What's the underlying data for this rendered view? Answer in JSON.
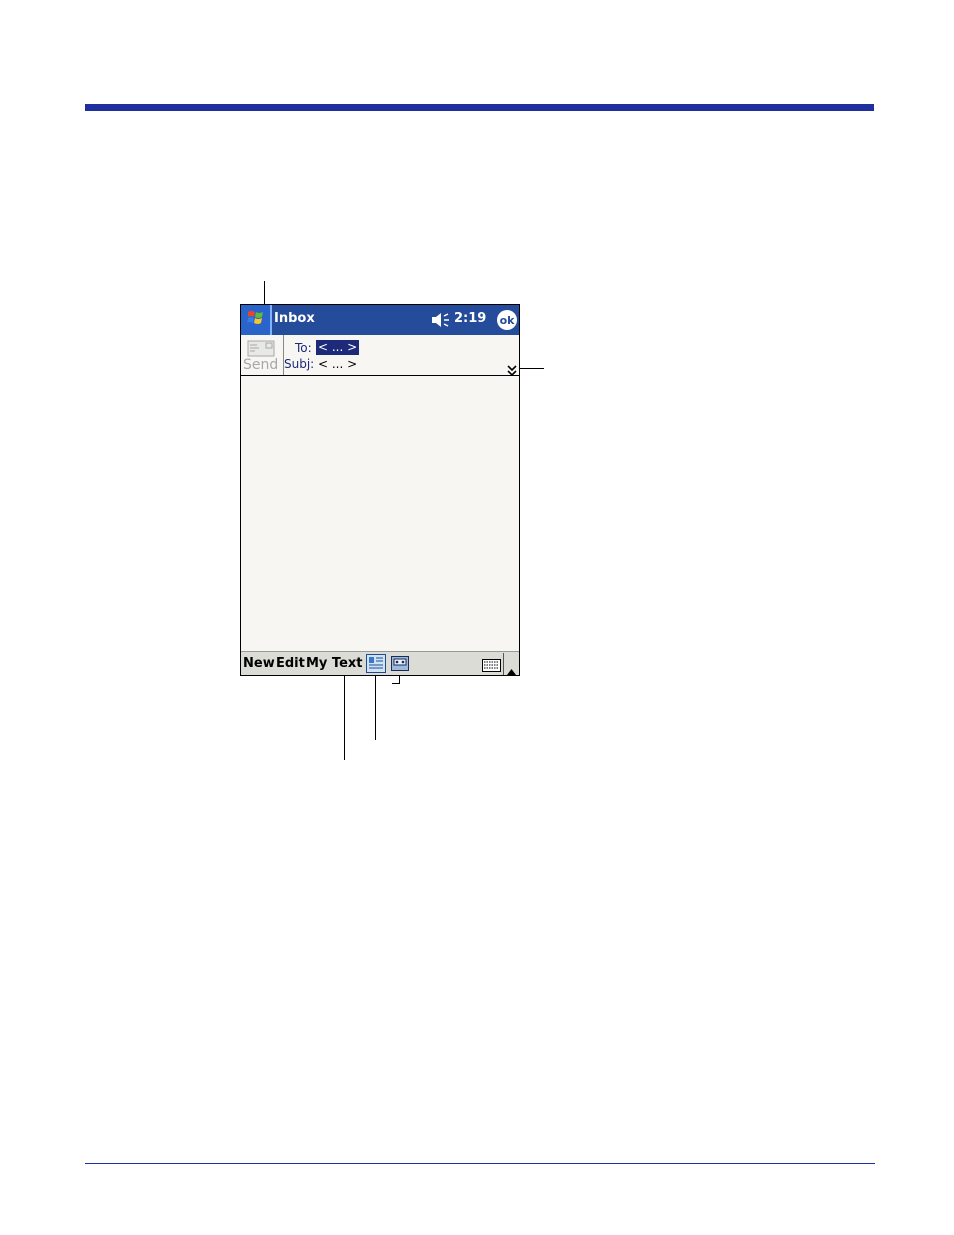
{
  "title_bar": {
    "app_title": "Inbox",
    "time": "2:19",
    "ok_label": "ok"
  },
  "compose": {
    "send_label": "Send",
    "to_label": "To:",
    "to_value": "< ... >",
    "subj_label": "Subj:",
    "subj_value": "< ... >"
  },
  "menu_bar": {
    "items": [
      "New",
      "Edit",
      "My Text"
    ]
  },
  "colors": {
    "title_bar": "#254b9b",
    "page_rule": "#1f2f9e",
    "body_bg": "#f7f6f2",
    "menu_bar": "#dcdcd6"
  },
  "icons": [
    "windows-start-icon",
    "speaker-icon",
    "envelope-icon",
    "expand-header-icon",
    "preview-icon",
    "voice-recording-icon",
    "keyboard-icon",
    "sip-arrow-icon"
  ]
}
